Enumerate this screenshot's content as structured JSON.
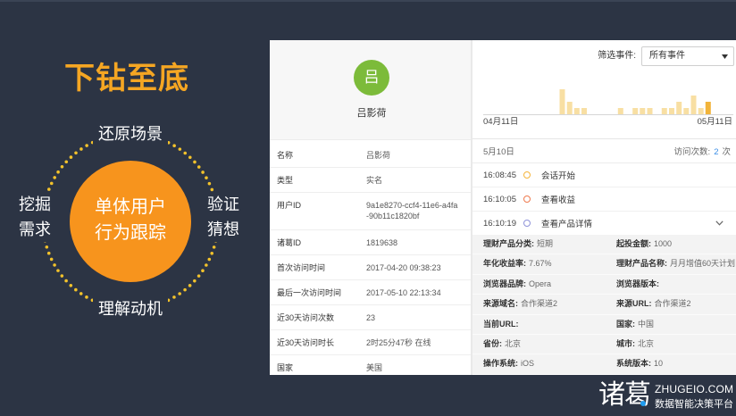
{
  "colors": {
    "slide_bg": "#2c3444",
    "title": "#f5a623",
    "ring_dots": "#f3c22b",
    "core_circle": "#f7941d",
    "avatar": "#7cbb3a",
    "visit_count": "#3a8ee6",
    "bar": "#f8dfa3",
    "bar_selected": "#f2b43a",
    "brand_accent": "#1f9cf0"
  },
  "slide": {
    "title": "下钻至底",
    "core_label": [
      "单体用户",
      "行为跟踪"
    ],
    "labels": {
      "top": "还原场景",
      "left": [
        "挖掘",
        "需求"
      ],
      "right": [
        "验证",
        "猜想"
      ],
      "bottom": "理解动机"
    }
  },
  "profile": {
    "avatar_letter": "吕",
    "name": "吕影荷",
    "rows": [
      {
        "label": "名称",
        "value": "吕影荷"
      },
      {
        "label": "类型",
        "value": "实名"
      },
      {
        "label": "用户ID",
        "value": "9a1e8270-ccf4-11e6-a4fa-90b11c1820bf"
      },
      {
        "label": "诸葛ID",
        "value": "1819638"
      },
      {
        "label": "首次访问时间",
        "value": "2017-04-20 09:38:23"
      },
      {
        "label": "最后一次访问时间",
        "value": "2017-05-10 22:13:34"
      },
      {
        "label": "近30天访问次数",
        "value": "23"
      },
      {
        "label": "近30天访问时长",
        "value": "2时25分47秒 在线"
      },
      {
        "label": "国家",
        "value": "美国"
      }
    ]
  },
  "events_panel": {
    "filter_label": "筛选事件:",
    "filter_value": "所有事件",
    "timeline": {
      "start_label": "04月11日",
      "end_label": "05月11日",
      "daily_visits": [
        0,
        0,
        0,
        0,
        0,
        0,
        0,
        0,
        0,
        4,
        2,
        1,
        1,
        0,
        0,
        0,
        0,
        1,
        0,
        1,
        1,
        1,
        0,
        1,
        1,
        2,
        1,
        3,
        1,
        2,
        0
      ],
      "selected_index": 29
    },
    "day": {
      "date": "5月10日",
      "visits_label": "访问次数:",
      "visits_count": "2",
      "visits_unit": "次"
    },
    "events": [
      {
        "time": "16:08:45",
        "name": "会话开始",
        "marker_color": "#f5b53c",
        "icon": "ring-marker-icon"
      },
      {
        "time": "16:10:05",
        "name": "查看收益",
        "marker_color": "#ef7a4e",
        "icon": "ring-marker-icon"
      },
      {
        "time": "16:10:19",
        "name": "查看产品详情",
        "marker_color": "#8f93d9",
        "icon": "ring-marker-icon"
      }
    ],
    "details": [
      [
        {
          "label": "理财产品分类:",
          "value": "短期"
        },
        {
          "label": "起投金额:",
          "value": "1000"
        }
      ],
      [
        {
          "label": "年化收益率:",
          "value": "7.67%"
        },
        {
          "label": "理财产品名称:",
          "value": "月月增值60天计划"
        }
      ],
      [
        {
          "label": "浏览器品牌:",
          "value": "Opera"
        },
        {
          "label": "浏览器版本:",
          "value": ""
        }
      ],
      [
        {
          "label": "来源域名:",
          "value": "合作渠道2"
        },
        {
          "label": "来源URL:",
          "value": "合作渠道2"
        }
      ],
      [
        {
          "label": "当前URL:",
          "value": ""
        },
        {
          "label": "国家:",
          "value": "中国"
        }
      ],
      [
        {
          "label": "省份:",
          "value": "北京"
        },
        {
          "label": "城市:",
          "value": "北京"
        }
      ],
      [
        {
          "label": "操作系统:",
          "value": "iOS"
        },
        {
          "label": "系统版本:",
          "value": "10"
        }
      ]
    ]
  },
  "brand": {
    "logo_text": "诸葛",
    "domain": "ZHUGEIO.COM",
    "tagline": "数据智能决策平台"
  }
}
